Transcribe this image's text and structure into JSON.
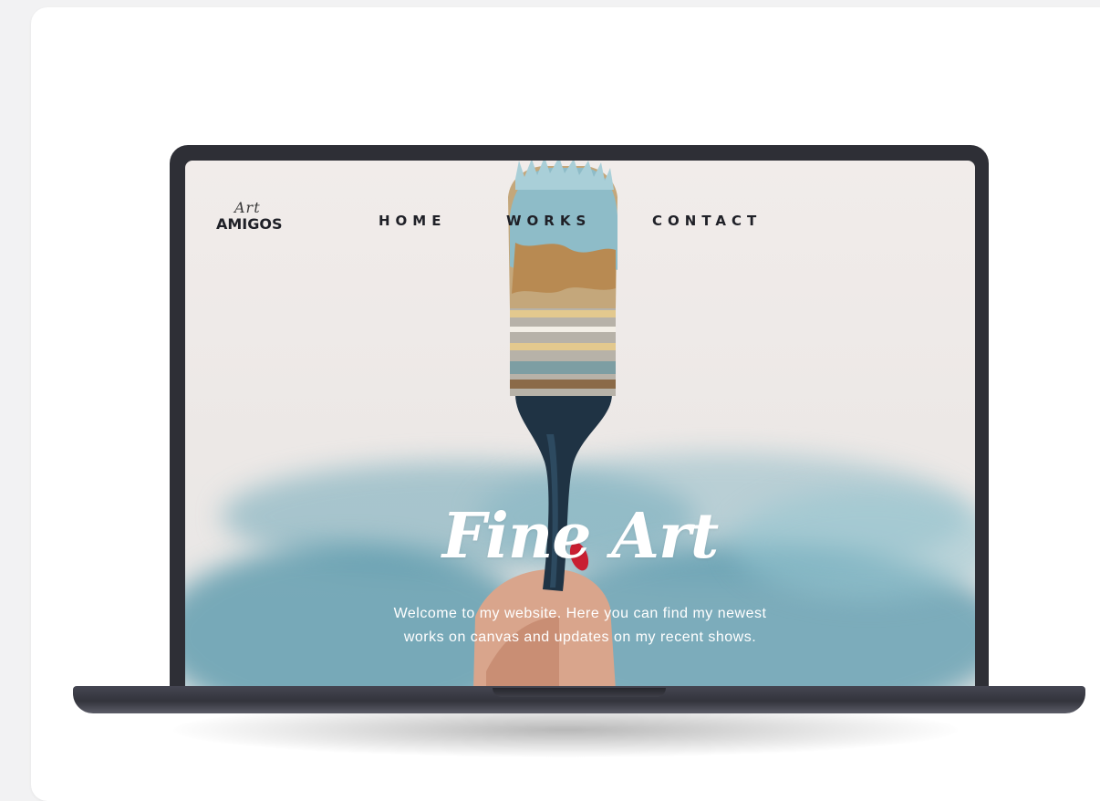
{
  "site": {
    "logo": {
      "script": "Art",
      "word": "AMIGOS"
    },
    "nav": [
      {
        "label": "HOME"
      },
      {
        "label": "WORKS"
      },
      {
        "label": "CONTACT"
      }
    ],
    "hero": {
      "title": "Fine Art",
      "text_line1": "Welcome to my website. Here you can find my newest",
      "text_line2": "works on canvas and updates on my recent shows."
    }
  },
  "colors": {
    "laptop": "#2e2f36",
    "paint_blue": "#6aa6b6",
    "handle": "#1f3344",
    "nav_text": "#1f2027"
  },
  "icons": {
    "hero_image": "paintbrush-illustration"
  }
}
